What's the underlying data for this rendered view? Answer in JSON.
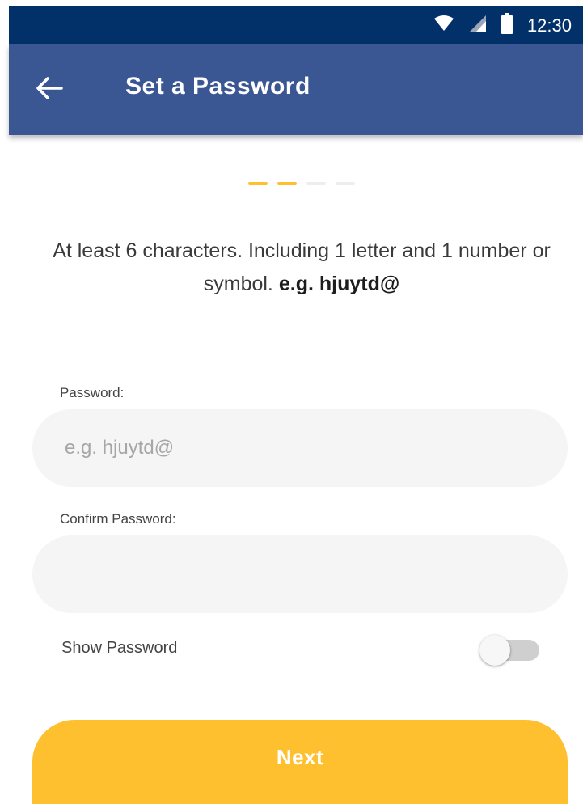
{
  "status_bar": {
    "time": "12:30",
    "icons": [
      "wifi-icon",
      "signal-icon",
      "battery-icon"
    ],
    "color": "#013168"
  },
  "app_bar": {
    "title": "Set a Password",
    "back_icon": "arrow-left-icon",
    "color": "#3a5794"
  },
  "progress": {
    "total_steps": 4,
    "completed_steps": 2,
    "active_color": "#fec02f",
    "inactive_color": "#eeeeee"
  },
  "hint": {
    "text": "At least 6 characters. Including 1 letter and 1 number or symbol.",
    "example": "e.g. hjuytd@"
  },
  "form": {
    "password_label": "Password:",
    "password_placeholder": "e.g. hjuytd@",
    "password_value": "",
    "confirm_label": "Confirm Password:",
    "confirm_placeholder": "",
    "confirm_value": "",
    "show_password_label": "Show Password",
    "show_password_on": false
  },
  "next_button": {
    "label": "Next",
    "color": "#fec02f"
  }
}
